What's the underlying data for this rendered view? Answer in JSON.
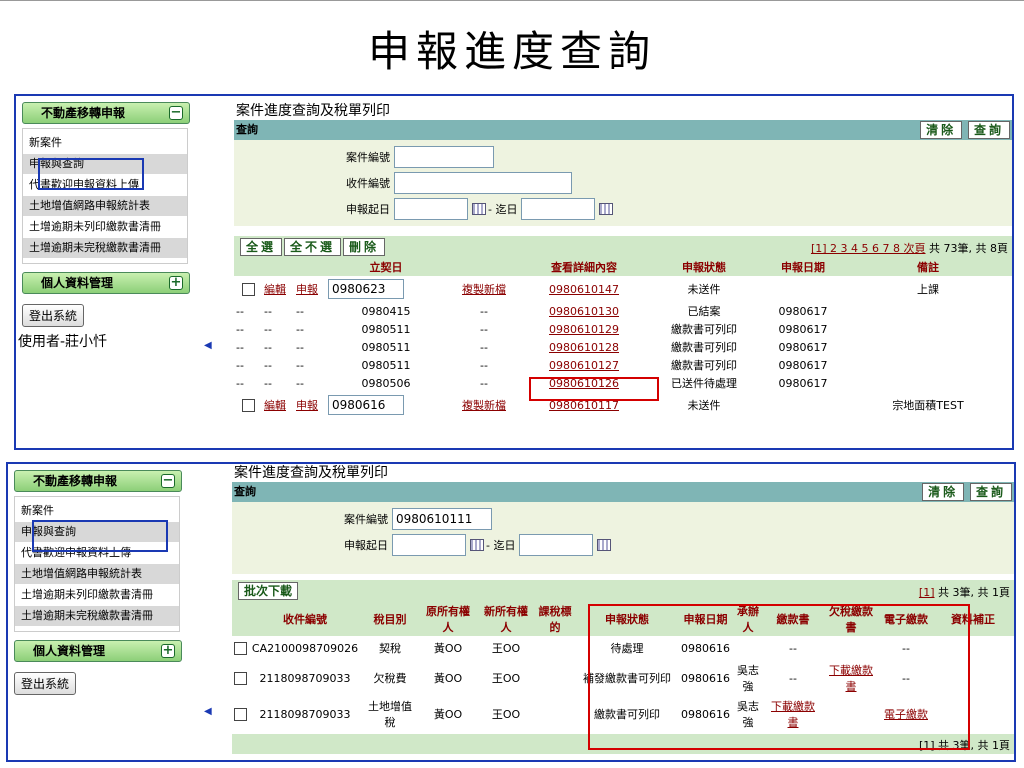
{
  "slide_title": "申報進度查詢",
  "top_panel": {
    "sidebar": {
      "section1": "不動產移轉申報",
      "items": [
        "新案件",
        "申報與查詢",
        "代書歡迎申報資料上傳",
        "土地增值網路申報統計表",
        "土增逾期未列印繳款書清冊",
        "土增逾期未完稅繳款書清冊"
      ],
      "section2": "個人資料管理",
      "logout": "登出系統",
      "user": "使用者-莊小忏"
    },
    "title": "案件進度查詢及稅單列印",
    "query_label": "查詢",
    "clear_btn": "清除",
    "search_btn": "查詢",
    "form": {
      "case_no_label": "案件編號",
      "receipt_no_label": "收件編號",
      "date_label": "申報起日",
      "to_label": "- 迄日"
    },
    "list_buttons": [
      "全選",
      "全不選",
      "刪除"
    ],
    "pager_pages": "[1] 2 3 4 5 6 7 8 次頁",
    "pager_total": "共 73筆, 共 8頁",
    "columns": [
      "立契日",
      "查看詳細內容",
      "申報狀態",
      "申報日期",
      "備註"
    ],
    "edit": "編輯",
    "report": "申報",
    "copy": "複製新檔",
    "rows": [
      {
        "date": "0980623",
        "detail": "0980610147",
        "status": "未送件",
        "rdate": "",
        "note": "上課",
        "editable": true
      },
      {
        "date": "0980415",
        "detail": "0980610130",
        "status": "已結案",
        "rdate": "0980617",
        "note": "",
        "editable": false
      },
      {
        "date": "0980511",
        "detail": "0980610129",
        "status": "繳款書可列印",
        "rdate": "0980617",
        "note": "",
        "editable": false
      },
      {
        "date": "0980511",
        "detail": "0980610128",
        "status": "繳款書可列印",
        "rdate": "0980617",
        "note": "",
        "editable": false
      },
      {
        "date": "0980511",
        "detail": "0980610127",
        "status": "繳款書可列印",
        "rdate": "0980617",
        "note": "",
        "editable": false
      },
      {
        "date": "0980506",
        "detail": "0980610126",
        "status": "已送件待處理",
        "rdate": "0980617",
        "note": "",
        "editable": false
      },
      {
        "date": "0980616",
        "detail": "0980610117",
        "status": "未送件",
        "rdate": "",
        "note": "宗地面積TEST",
        "editable": true
      }
    ],
    "dash": "--"
  },
  "bottom_panel": {
    "sidebar": {
      "section1": "不動產移轉申報",
      "items": [
        "新案件",
        "申報與查詢",
        "代書歡迎申報資料上傳",
        "土地增值網路申報統計表",
        "土增逾期未列印繳款書清冊",
        "土增逾期未完稅繳款書清冊"
      ],
      "section2": "個人資料管理",
      "logout": "登出系統"
    },
    "title": "案件進度查詢及稅單列印",
    "query_label": "查詢",
    "clear_btn": "清除",
    "search_btn": "查詢",
    "form": {
      "case_no_label": "案件編號",
      "case_no_value": "0980610111",
      "date_label": "申報起日",
      "to_label": "- 迄日"
    },
    "batch_btn": "批次下載",
    "pager_pages": "[1]",
    "pager_total": "共 3筆, 共 1頁",
    "footer_pager": "[1] 共 3筆, 共 1頁",
    "columns": [
      "收件編號",
      "稅目別",
      "原所有權人",
      "新所有權人",
      "課稅標的",
      "申報狀態",
      "申報日期",
      "承辦人",
      "繳款書",
      "欠稅繳款書",
      "電子繳款",
      "資料補正"
    ],
    "rows": [
      {
        "no": "CA2100098709026",
        "tax": "契稅",
        "old": "黃OO",
        "new": "王OO",
        "status": "待處理",
        "date": "0980616",
        "officer": "",
        "bill": "--",
        "arrears": "",
        "epay": "--"
      },
      {
        "no": "2118098709033",
        "tax": "欠稅費",
        "old": "黃OO",
        "new": "王OO",
        "status": "補發繳款書可列印",
        "date": "0980616",
        "officer": "吳志強",
        "bill": "--",
        "arrears": "下載繳款書",
        "epay": "--"
      },
      {
        "no": "2118098709033",
        "tax": "土地增值稅",
        "old": "黃OO",
        "new": "王OO",
        "status": "繳款書可列印",
        "date": "0980616",
        "officer": "吳志強",
        "bill": "下載繳款書",
        "arrears": "",
        "epay": "電子繳款"
      }
    ]
  }
}
